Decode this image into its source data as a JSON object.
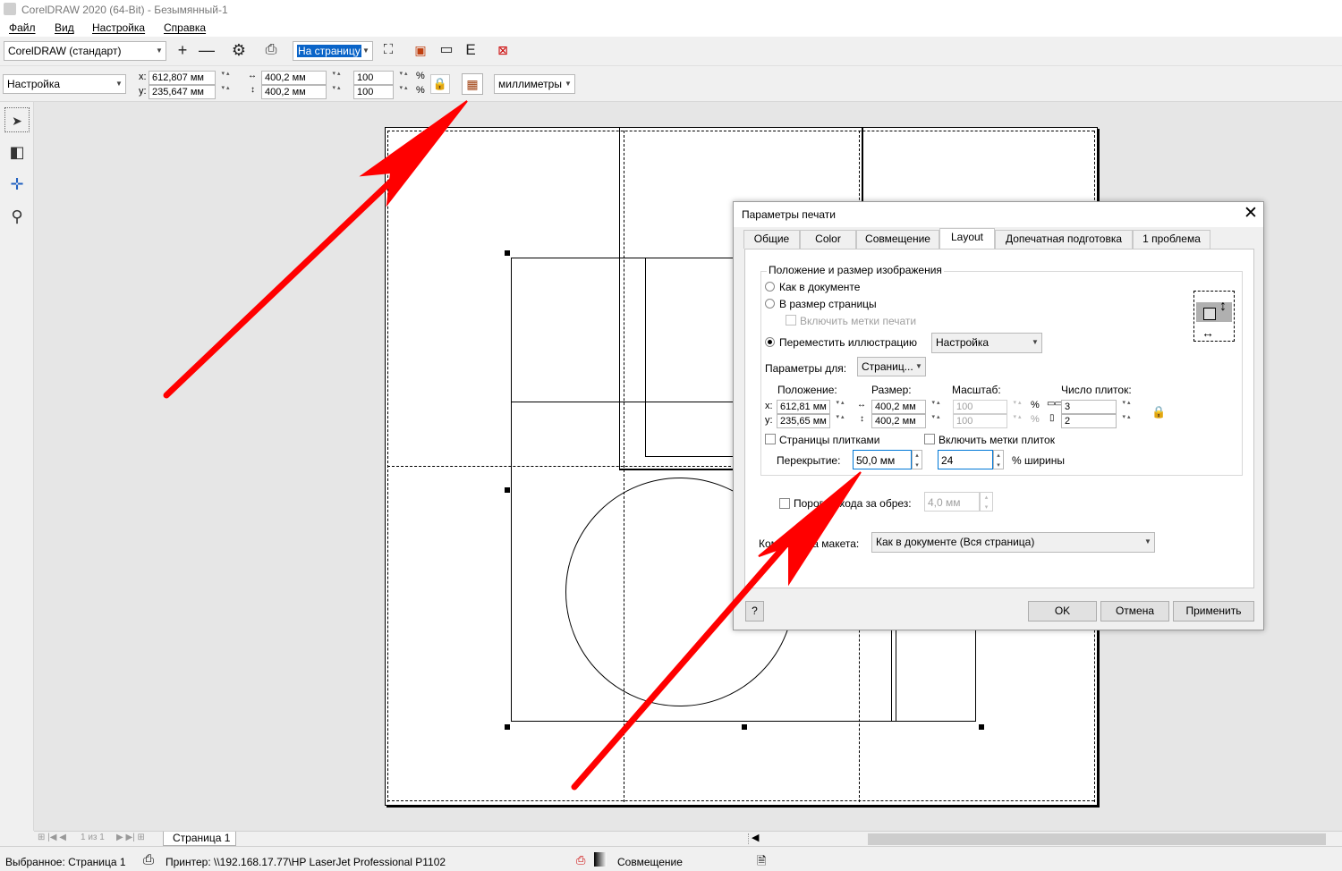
{
  "window": {
    "title": "CorelDRAW 2020 (64-Bit) - Безымянный-1"
  },
  "menu": [
    "Файл",
    "Вид",
    "Настройка",
    "Справка"
  ],
  "toolbar1": {
    "workspace": "CorelDRAW (стандарт)",
    "zoom_mode": "На страницу",
    "icons": [
      "zoom-in-icon",
      "zoom-out-icon",
      "gear-icon",
      "print-icon",
      "fit-page-icon",
      "tile-icon",
      "frame-icon",
      "text-e-icon",
      "close-preview-icon"
    ]
  },
  "toolbar2": {
    "preset": "Настройка",
    "x_label": "x:",
    "y_label": "y:",
    "x_value": "612,807 мм",
    "y_value": "235,647 мм",
    "width_value": "400,2 мм",
    "height_value": "400,2 мм",
    "scale_w": "100",
    "scale_h": "100",
    "pct1": "%",
    "pct2": "%",
    "units": "миллиметры"
  },
  "tools": [
    "pick-tool-icon",
    "imposition-tool-icon",
    "marks-tool-icon",
    "zoom-tool-icon"
  ],
  "dialog": {
    "title": "Параметры печати",
    "tabs": [
      "Общие",
      "Color",
      "Совмещение",
      "Layout",
      "Допечатная подготовка",
      "1 проблема"
    ],
    "active_tab": "Layout",
    "group_title": "Положение и размер изображения",
    "opt_as_doc": "Как в документе",
    "opt_fit_page": "В размер страницы",
    "opt_include_marks": "Включить метки печати",
    "opt_reposition": "Переместить иллюстрацию",
    "reposition_combo": "Настройка",
    "params_for_label": "Параметры для:",
    "params_for_value": "Страниц...",
    "col_position": "Положение:",
    "col_size": "Размер:",
    "col_scale": "Масштаб:",
    "col_tiles": "Число плиток:",
    "x_label": "x:",
    "y_label": "y:",
    "pos_x": "612,81 мм",
    "pos_y": "235,65 мм",
    "size_w": "400,2 мм",
    "size_h": "400,2 мм",
    "scale_w": "100",
    "scale_h": "100",
    "pct1": "%",
    "pct2": "%",
    "tiles_x": "3",
    "tiles_y": "2",
    "tile_pages": "Страницы плитками",
    "tile_marks": "Включить метки плиток",
    "overlap_label": "Перекрытие:",
    "overlap_value": "50,0 мм",
    "overlap_pct": "24",
    "overlap_pct_label": "% ширины",
    "bleed_label": "Порог выхода за обрез:",
    "bleed_value": "4,0 мм",
    "layout_label": "Компоновка макета:",
    "layout_value": "Как в документе (Вся страница)",
    "help": "?",
    "ok": "OK",
    "cancel": "Отмена",
    "apply": "Применить"
  },
  "pagebar": {
    "page_info": "1 из 1",
    "tab": "Страница 1"
  },
  "status": {
    "selected": "Выбранное: Страница 1",
    "printer": "Принтер: \\\\192.168.17.77\\HP LaserJet Professional P1102",
    "mode": "Совмещение"
  },
  "annotation_color": "#ff0000"
}
